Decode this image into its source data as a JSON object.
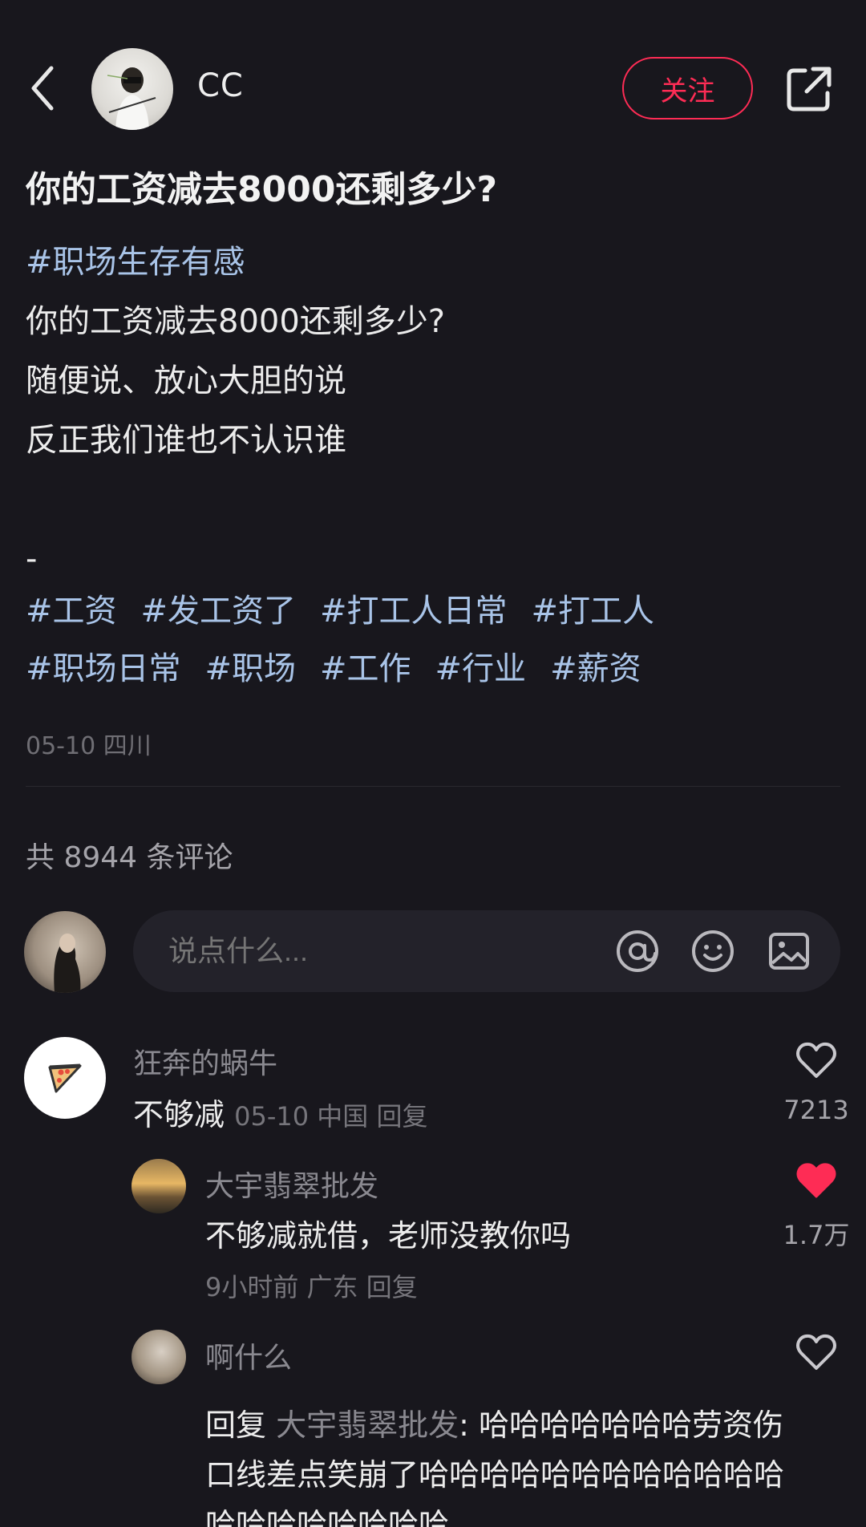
{
  "header": {
    "author_name": "CC",
    "follow_label": "关注"
  },
  "post": {
    "title": "你的工资减去8000还剩多少?",
    "topic": "#职场生存有感",
    "lines": [
      "你的工资减去8000还剩多少?",
      "随便说、放心大胆的说",
      "反正我们谁也不认识谁",
      "",
      "-"
    ],
    "tags": [
      "#工资",
      "#发工资了",
      "#打工人日常",
      "#打工人",
      "#职场日常",
      "#职场",
      "#工作",
      "#行业",
      "#薪资"
    ],
    "meta": "05-10 四川"
  },
  "comments_header": {
    "count_text": "共 8944 条评论",
    "input_placeholder": "说点什么..."
  },
  "comments": [
    {
      "name": "狂奔的蜗牛",
      "text": "不够减",
      "meta": "05-10 中国 回复",
      "likes": "7213",
      "liked": false
    }
  ],
  "replies": [
    {
      "name": "大宇翡翠批发",
      "text": "不够减就借，老师没教你吗",
      "meta": "9小时前 广东 回复",
      "likes": "1.7万",
      "liked": true
    },
    {
      "name": "啊什么",
      "reply_prefix": "回复 ",
      "reply_target": "大宇翡翠批发",
      "reply_body": ": 哈哈哈哈哈哈哈劳资伤口线差点笑崩了哈哈哈哈哈哈哈哈哈哈哈哈哈哈哈哈哈哈哈哈",
      "liked": false
    }
  ],
  "colors": {
    "background": "#18171d",
    "accent": "#fe2c55",
    "topic": "#a9c4e8"
  },
  "icons": [
    "back-icon",
    "share-icon",
    "at-icon",
    "emoji-icon",
    "image-icon",
    "heart-outline-icon",
    "heart-filled-icon"
  ]
}
